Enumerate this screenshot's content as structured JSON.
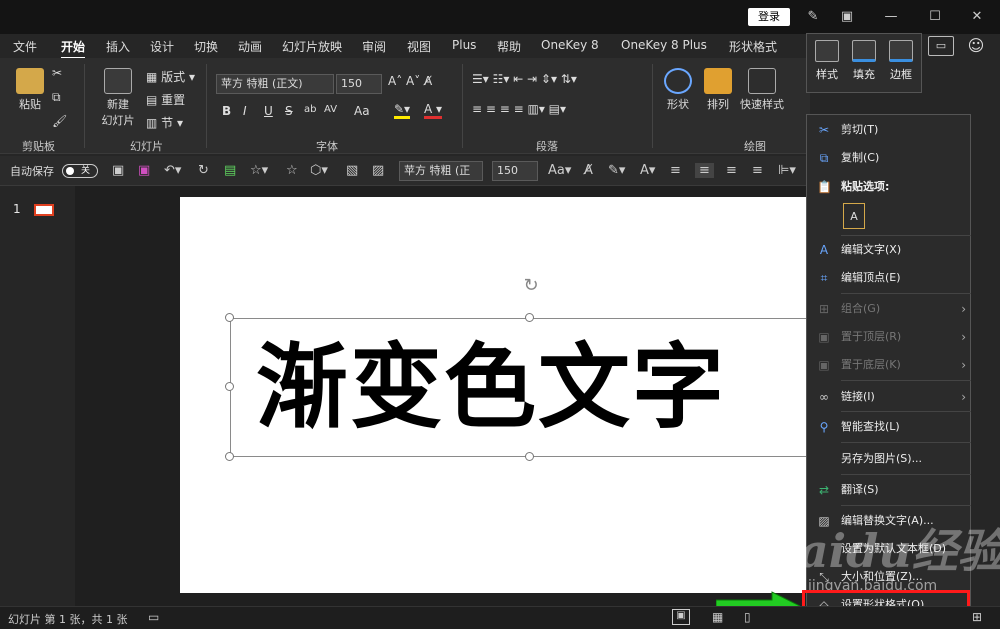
{
  "titlebar": {
    "login": "登录",
    "icons": [
      "pen-icon",
      "ribbon-display-icon",
      "minimize-icon",
      "maximize-icon",
      "close-icon"
    ]
  },
  "tabs": [
    "文件",
    "开始",
    "插入",
    "设计",
    "切换",
    "动画",
    "幻灯片放映",
    "审阅",
    "视图",
    "Plus",
    "帮助",
    "OneKey 8",
    "OneKey 8 Plus",
    "形状格式"
  ],
  "ribbon": {
    "clipboard": {
      "paste": "粘贴",
      "label": "剪贴板"
    },
    "slides": {
      "new_slide": "新建\n幻灯片",
      "new_slide_1": "新建",
      "new_slide_2": "幻灯片",
      "layout": "版式",
      "reset": "重置",
      "section": "节",
      "label": "幻灯片"
    },
    "font": {
      "family": "苹方 特粗 (正文)",
      "size": "150",
      "label": "字体",
      "buttons": [
        "B",
        "I",
        "U",
        "S",
        "ab",
        "AV",
        "Aa"
      ]
    },
    "paragraph": {
      "label": "段落"
    },
    "drawing": {
      "shapes": "形状",
      "arrange": "排列",
      "quick_styles": "快速样式",
      "label": "绘图"
    }
  },
  "qat": {
    "autosave": "自动保存",
    "toggle": "关",
    "font_family": "苹方 特粗 (正",
    "font_size": "150"
  },
  "thumbnail": {
    "number": "1"
  },
  "slide": {
    "text": "渐变色文字"
  },
  "minibar": {
    "style": "样式",
    "fill": "填充",
    "outline": "边框"
  },
  "context_menu": [
    {
      "label": "剪切(T)",
      "icon": "scissors-icon",
      "disabled": false
    },
    {
      "label": "复制(C)",
      "icon": "copy-icon",
      "disabled": false
    },
    {
      "label": "粘贴选项:",
      "icon": "paste-icon",
      "disabled": false
    },
    {
      "label": "编辑文字(X)",
      "icon": "edit-text-icon",
      "disabled": false
    },
    {
      "label": "编辑顶点(E)",
      "icon": "edit-points-icon",
      "disabled": false
    },
    {
      "label": "组合(G)",
      "icon": "group-icon",
      "disabled": true
    },
    {
      "label": "置于顶层(R)",
      "icon": "bring-front-icon",
      "disabled": true
    },
    {
      "label": "置于底层(K)",
      "icon": "send-back-icon",
      "disabled": true
    },
    {
      "label": "链接(I)",
      "icon": "link-icon",
      "disabled": false
    },
    {
      "label": "智能查找(L)",
      "icon": "search-icon",
      "disabled": false
    },
    {
      "label": "另存为图片(S)...",
      "icon": "",
      "disabled": false
    },
    {
      "label": "翻译(S)",
      "icon": "translate-icon",
      "disabled": false
    },
    {
      "label": "编辑替换文字(A)...",
      "icon": "alt-text-icon",
      "disabled": false
    },
    {
      "label": "设置为默认文本框(D)",
      "icon": "",
      "disabled": false
    },
    {
      "label": "大小和位置(Z)...",
      "icon": "size-icon",
      "disabled": false
    },
    {
      "label": "设置形状格式(O)...",
      "icon": "format-shape-icon",
      "disabled": false
    }
  ],
  "status": {
    "slide_info": "幻灯片 第 1 张，共 1 张"
  },
  "watermark": {
    "main": "Baidu经验",
    "sub": "jingyan.baidu.com"
  },
  "colors": {
    "accent_red": "#ff1a1a",
    "arrow_green": "#22cc22",
    "icon_blue": "#6aa7ff"
  }
}
